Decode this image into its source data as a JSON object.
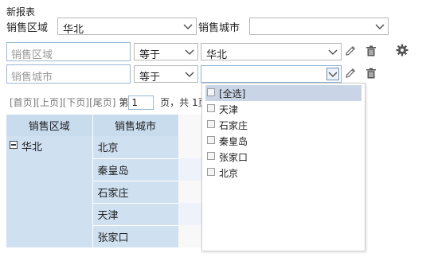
{
  "report_title": "新报表",
  "filters": {
    "region_label": "销售区域",
    "region_value": "华北",
    "city_label": "销售城市",
    "city_value": ""
  },
  "conditions": [
    {
      "field_placeholder": "销售区域",
      "operator": "等于",
      "value": "华北"
    },
    {
      "field_placeholder": "销售城市",
      "operator": "等于",
      "value": ""
    }
  ],
  "pager": {
    "first": "[首页]",
    "prev": "[上页]",
    "next": "[下页]",
    "last": "[尾页]",
    "page_prefix": "第",
    "page_value": "1",
    "page_suffix": "页，共 1页"
  },
  "table": {
    "headers": [
      "销售区域",
      "销售城市"
    ],
    "group_label": "华北",
    "expand_symbol": "−",
    "cities": [
      "北京",
      "秦皇岛",
      "石家庄",
      "天津",
      "张家口"
    ]
  },
  "dropdown": {
    "items": [
      "[全选]",
      "天津",
      "石家庄",
      "秦皇岛",
      "张家口",
      "北京"
    ],
    "highlighted_index": 0
  },
  "icons": {
    "edit": "pencil-icon",
    "delete": "trash-icon",
    "settings": "gear-icon"
  }
}
